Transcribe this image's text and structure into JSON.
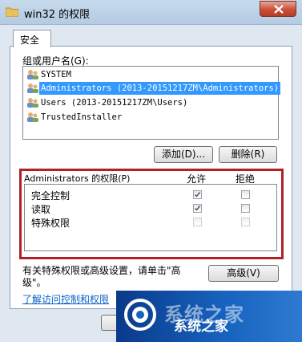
{
  "window": {
    "title": "win32 的权限"
  },
  "tabs": [
    {
      "label": "安全"
    }
  ],
  "group": {
    "label": "组或用户名(G):",
    "items": [
      {
        "label": "SYSTEM",
        "selected": false
      },
      {
        "label": "Administrators (2013-20151217ZM\\Administrators)",
        "selected": true
      },
      {
        "label": "Users (2013-20151217ZM\\Users)",
        "selected": false
      },
      {
        "label": "TrustedInstaller",
        "selected": false
      }
    ],
    "add_label": "添加(D)...",
    "remove_label": "删除(R)"
  },
  "permissions": {
    "header": "Administrators 的权限(P)",
    "allow_label": "允许",
    "deny_label": "拒绝",
    "rows": [
      {
        "name": "完全控制",
        "allow": true,
        "deny": false
      },
      {
        "name": "读取",
        "allow": true,
        "deny": false
      },
      {
        "name": "特殊权限",
        "allow": false,
        "deny": false
      }
    ]
  },
  "hint": {
    "line1": "有关特殊权限或高级设置，请单击\"高",
    "line2": "级\"。"
  },
  "advanced_label": "高级(V)",
  "help_link": "了解访问控制和权限",
  "watermark": {
    "text": "系统之家"
  },
  "colors": {
    "highlight": "#b21f25",
    "selection": "#3399ff",
    "link": "#0b63c8"
  }
}
